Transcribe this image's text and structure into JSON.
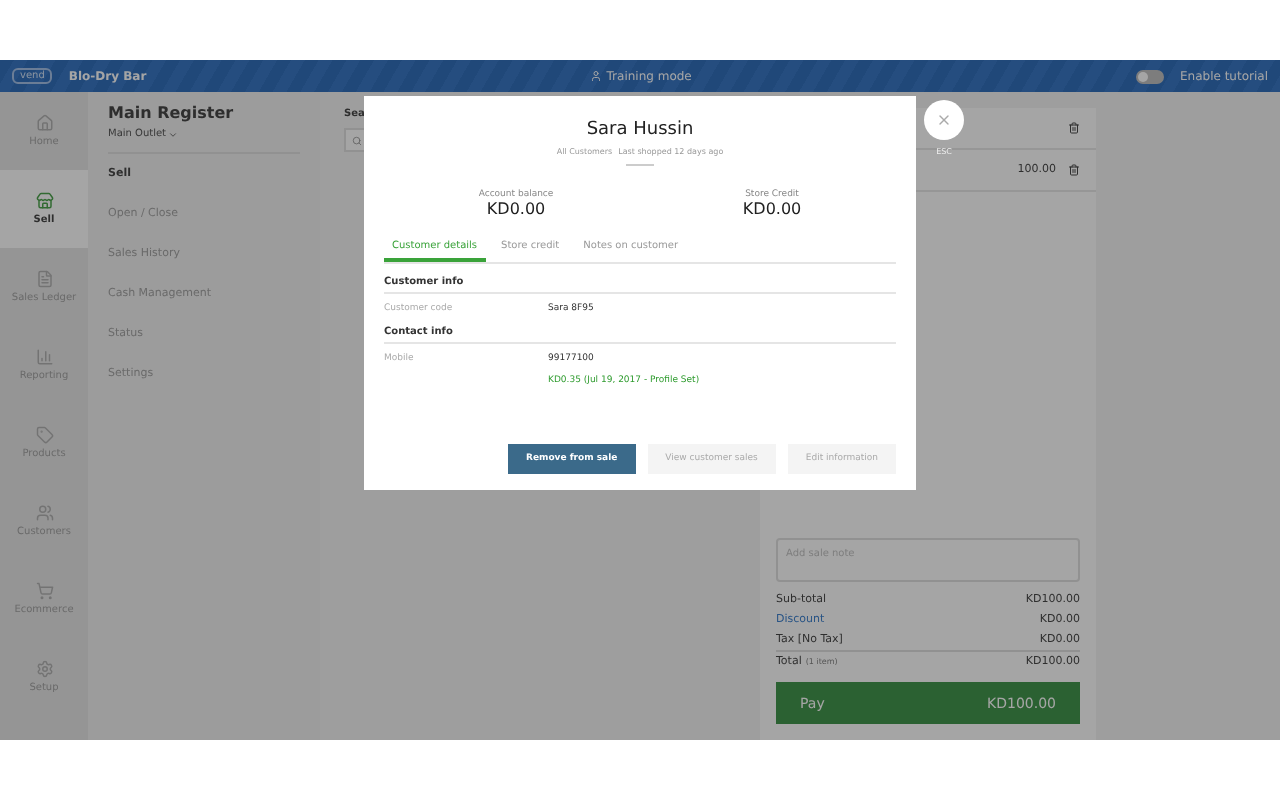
{
  "header": {
    "logo": "vend",
    "store": "Blo-Dry Bar",
    "training": "Training mode",
    "tutorial": {
      "label": "Enable tutorial",
      "on": false
    }
  },
  "nav": [
    {
      "label": "Home",
      "selected": false
    },
    {
      "label": "Sell",
      "selected": true
    },
    {
      "label": "Sales Ledger",
      "selected": false
    },
    {
      "label": "Reporting",
      "selected": false
    },
    {
      "label": "Products",
      "selected": false
    },
    {
      "label": "Customers",
      "selected": false
    },
    {
      "label": "Ecommerce",
      "selected": false
    },
    {
      "label": "Setup",
      "selected": false
    }
  ],
  "register": {
    "title": "Main Register",
    "outlet": "Main Outlet"
  },
  "menu": [
    {
      "label": "Sell",
      "selected": true
    },
    {
      "label": "Open / Close",
      "selected": false
    },
    {
      "label": "Sales History",
      "selected": false
    },
    {
      "label": "Cash Management",
      "selected": false
    },
    {
      "label": "Status",
      "selected": false
    },
    {
      "label": "Settings",
      "selected": false
    }
  ],
  "search": {
    "label": "Sea"
  },
  "cart": {
    "lines": [
      {
        "kind": "plain"
      },
      {
        "kind": "priced",
        "price": "100.00"
      }
    ]
  },
  "note": {
    "placeholder": "Add sale note"
  },
  "totals": [
    {
      "label": "Sub-total",
      "value": "KD100.00",
      "kind": "plain"
    },
    {
      "label": "Discount",
      "value": "KD0.00",
      "kind": "link"
    },
    {
      "label": "Tax [No Tax]",
      "value": "KD0.00",
      "kind": "plain"
    },
    {
      "label": "Total",
      "sub": "(1 item)",
      "value": "KD100.00",
      "kind": "total"
    }
  ],
  "pay": {
    "label": "Pay",
    "amount": "KD100.00"
  },
  "modal": {
    "name": "Sara Hussin",
    "crumbs": [
      "All Customers",
      "Last shopped 12 days ago"
    ],
    "balances": [
      {
        "label": "Account balance",
        "value": "KD0.00"
      },
      {
        "label": "Store Credit",
        "value": "KD0.00"
      }
    ],
    "tabs": [
      {
        "label": "Customer details",
        "selected": true
      },
      {
        "label": "Store credit",
        "selected": false
      },
      {
        "label": "Notes on customer",
        "selected": false
      }
    ],
    "sections": [
      {
        "title": "Customer info",
        "rows": [
          {
            "label": "Customer code",
            "value": "Sara 8F95"
          }
        ]
      },
      {
        "title": "Contact info",
        "rows": [
          {
            "label": "Mobile",
            "value": "99177100",
            "note": "KD0.35 (Jul 19, 2017 - Profile Set)"
          }
        ]
      }
    ],
    "buttons": [
      {
        "label": "Remove from sale",
        "kind": "primary"
      },
      {
        "label": "View customer sales",
        "kind": "secondary"
      },
      {
        "label": "Edit information",
        "kind": "secondary"
      }
    ],
    "close": {
      "label": "ESC"
    }
  }
}
